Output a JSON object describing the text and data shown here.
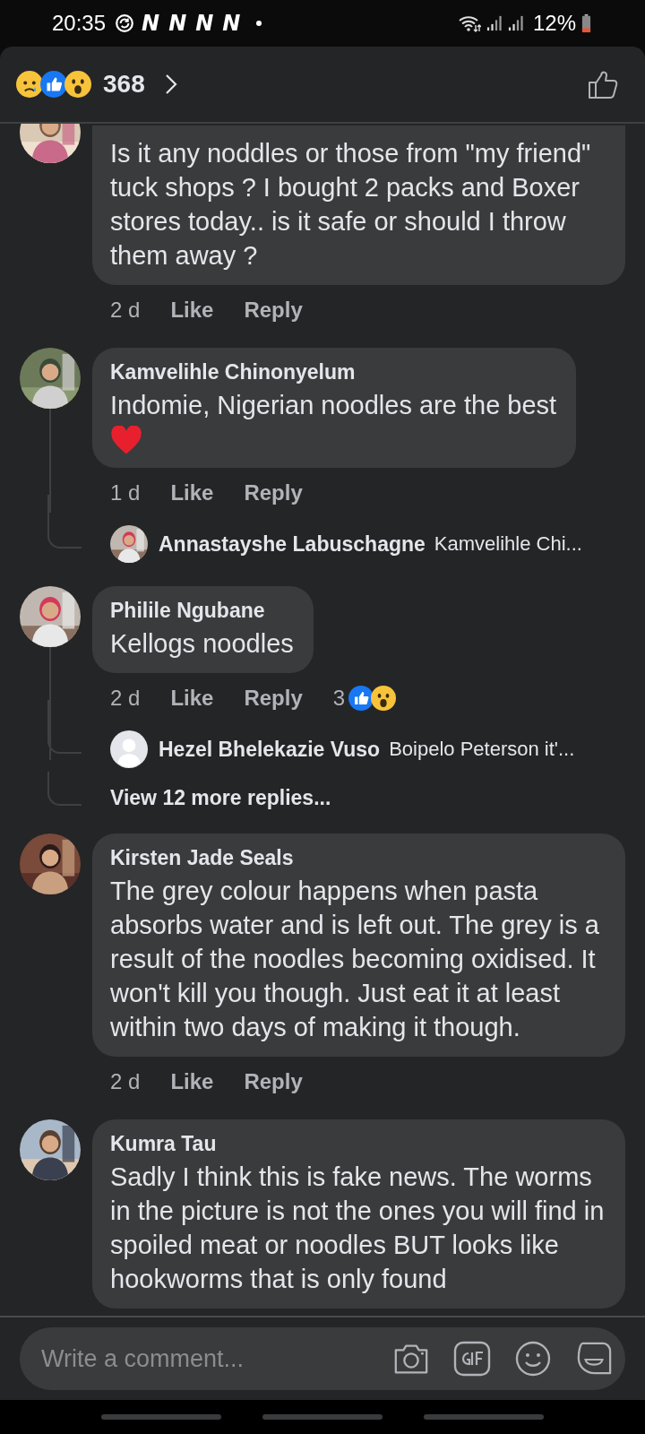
{
  "status_bar": {
    "time": "20:35",
    "notification_icons": [
      "N",
      "N",
      "N",
      "N"
    ],
    "battery": "12%"
  },
  "header": {
    "reactions": [
      {
        "kind": "sad"
      },
      {
        "kind": "like"
      },
      {
        "kind": "wow"
      }
    ],
    "reaction_count": "368"
  },
  "comments": [
    {
      "avatar": {
        "kind": "picture"
      },
      "text": "Is it any noddles or those from \"my friend\" tuck shops ? I bought 2 packs and Boxer stores today.. is it safe or should I throw them away ?",
      "time": "2 d",
      "like": "Like",
      "reply": "Reply"
    },
    {
      "avatar": {
        "kind": "picture"
      },
      "author": "Kamvelihle Chinonyelum",
      "text": "Indomie, Nigerian noodles are the best",
      "heart": true,
      "time": "1 d",
      "like": "Like",
      "reply": "Reply",
      "replies": [
        {
          "avatar": {
            "kind": "picture"
          },
          "author": "Annastayshe Labuschagne",
          "preview": "Kamvelihle Chi..."
        }
      ]
    },
    {
      "avatar": {
        "kind": "picture"
      },
      "author": "Philile Ngubane",
      "text": "Kellogs noodles",
      "time": "2 d",
      "like": "Like",
      "reply": "Reply",
      "reaction_count": "3",
      "reactions": [
        {
          "kind": "like"
        },
        {
          "kind": "wow"
        }
      ],
      "replies": [
        {
          "avatar": {
            "kind": "default"
          },
          "author": "Hezel Bhelekazie Vuso",
          "preview": "Boipelo Peterson it'..."
        }
      ],
      "view_more": "View 12 more replies..."
    },
    {
      "avatar": {
        "kind": "picture"
      },
      "author": "Kirsten Jade Seals",
      "text": "The grey colour happens when pasta absorbs water and is left out. The grey is a result of the noodles becoming oxidised. It won't kill you though. Just eat it at least within two days of making it though.",
      "time": "2 d",
      "like": "Like",
      "reply": "Reply"
    },
    {
      "avatar": {
        "kind": "picture"
      },
      "author": "Kumra Tau",
      "text": "Sadly I think this is fake news. The worms in the picture is not the ones you will find in spoiled meat or noodles BUT looks like hookworms that is only found"
    }
  ],
  "composer": {
    "placeholder": "Write a comment..."
  }
}
